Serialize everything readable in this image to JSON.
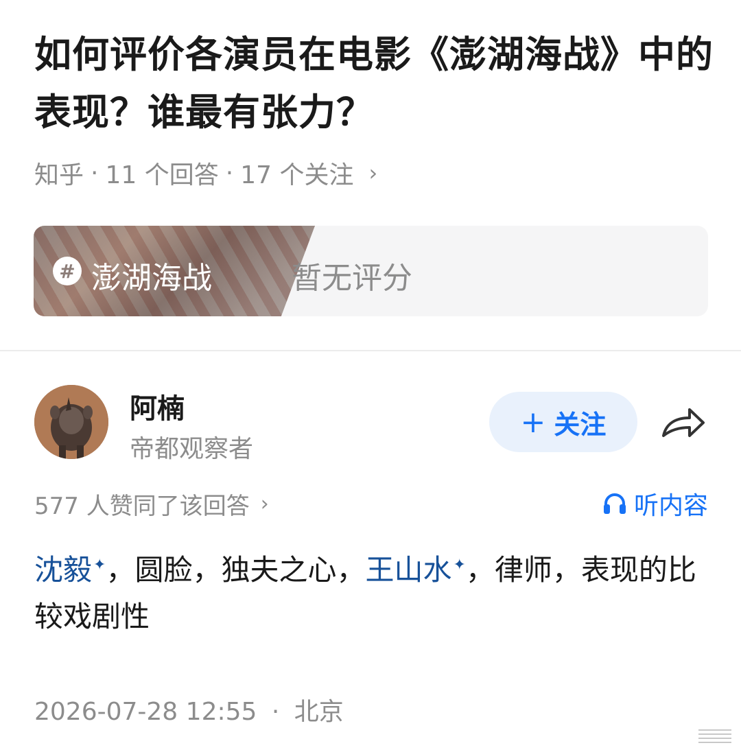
{
  "question": {
    "title": "如何评价各演员在电影《澎湖海战》中的表现？谁最有张力？",
    "source": "知乎",
    "answers": "11 个回答",
    "followers": "17 个关注"
  },
  "topic": {
    "name": "澎湖海战",
    "rating": "暂无评分",
    "icon": "hash-icon"
  },
  "author": {
    "name": "阿楠",
    "bio": "帝都观察者",
    "follow_label": "关注",
    "avatar": "rhino-avatar"
  },
  "answer": {
    "likes": "577 人赞同了该回答",
    "listen_label": "听内容",
    "entity_1": "沈毅",
    "text_1": "，圆脸，独夫之心，",
    "entity_2": "王山水",
    "text_2": "，律师，表现的比较戏剧性",
    "time": "2026-07-28 12:55",
    "location": "北京"
  },
  "colors": {
    "accent": "#1772f6",
    "entity": "#175199",
    "muted": "#8c8c8c"
  }
}
